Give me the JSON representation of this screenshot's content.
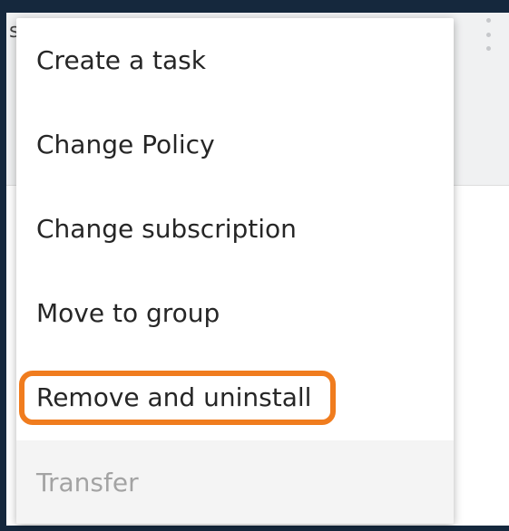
{
  "background": {
    "frame_color": "#15283d",
    "header_partial_char": "s"
  },
  "kebab": {
    "icon": "kebab-vertical-icon"
  },
  "menu": {
    "items": [
      {
        "label": "Create a task",
        "enabled": true
      },
      {
        "label": "Change Policy",
        "enabled": true
      },
      {
        "label": "Change subscription",
        "enabled": true
      },
      {
        "label": "Move to group",
        "enabled": true
      },
      {
        "label": "Remove and uninstall",
        "enabled": true,
        "highlighted": true
      },
      {
        "label": "Transfer",
        "enabled": false
      }
    ]
  },
  "highlight": {
    "color": "#f07c1e",
    "target": "Remove and uninstall"
  }
}
